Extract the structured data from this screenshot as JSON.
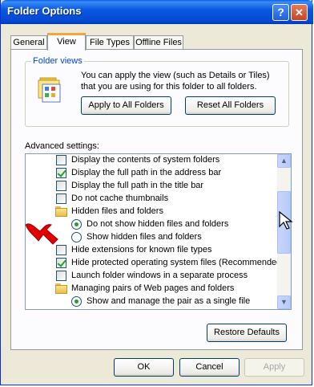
{
  "window": {
    "title": "Folder Options",
    "help_glyph": "?",
    "close_glyph": "✕"
  },
  "tabs": [
    "General",
    "View",
    "File Types",
    "Offline Files"
  ],
  "active_tab": "View",
  "folder_views": {
    "legend": "Folder views",
    "description": "You can apply the view (such as Details or Tiles) that you are using for this folder to all folders.",
    "apply_button": "Apply to All Folders",
    "reset_button": "Reset All Folders"
  },
  "advanced": {
    "label": "Advanced settings:",
    "items": [
      {
        "type": "checkbox",
        "checked": false,
        "label": "Display the contents of system folders"
      },
      {
        "type": "checkbox",
        "checked": true,
        "label": "Display the full path in the address bar"
      },
      {
        "type": "checkbox",
        "checked": false,
        "label": "Display the full path in the title bar"
      },
      {
        "type": "checkbox",
        "checked": false,
        "label": "Do not cache thumbnails"
      },
      {
        "type": "folder",
        "label": "Hidden files and folders"
      },
      {
        "type": "radio",
        "checked": true,
        "label": "Do not show hidden files and folders"
      },
      {
        "type": "radio",
        "checked": false,
        "label": "Show hidden files and folders"
      },
      {
        "type": "checkbox",
        "checked": false,
        "label": "Hide extensions for known file types"
      },
      {
        "type": "checkbox",
        "checked": true,
        "label": "Hide protected operating system files (Recommended)"
      },
      {
        "type": "checkbox",
        "checked": false,
        "label": "Launch folder windows in a separate process"
      },
      {
        "type": "folder",
        "label": "Managing pairs of Web pages and folders"
      },
      {
        "type": "radio",
        "checked": true,
        "label": "Show and manage the pair as a single file"
      }
    ],
    "scroll_up_glyph": "▲",
    "scroll_down_glyph": "▼"
  },
  "restore_defaults_button": "Restore Defaults",
  "footer": {
    "ok": "OK",
    "cancel": "Cancel",
    "apply": "Apply"
  },
  "colors": {
    "titlebar": "#0a58e0",
    "tab_highlight": "#f7a43a",
    "check_green": "#21a121",
    "annotation_red": "#e00000"
  }
}
